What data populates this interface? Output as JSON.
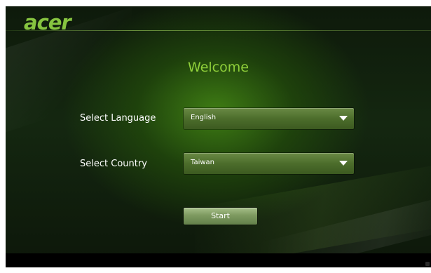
{
  "brand": {
    "logo_text": "acer"
  },
  "welcome": {
    "title": "Welcome"
  },
  "form": {
    "language": {
      "label": "Select Language",
      "value": "English"
    },
    "country": {
      "label": "Select Country",
      "value": "Taiwan"
    },
    "start_label": "Start"
  },
  "colors": {
    "accent": "#8fcf3a",
    "background": "#142710"
  },
  "icons": {
    "dropdown": "triangle-down-icon"
  }
}
